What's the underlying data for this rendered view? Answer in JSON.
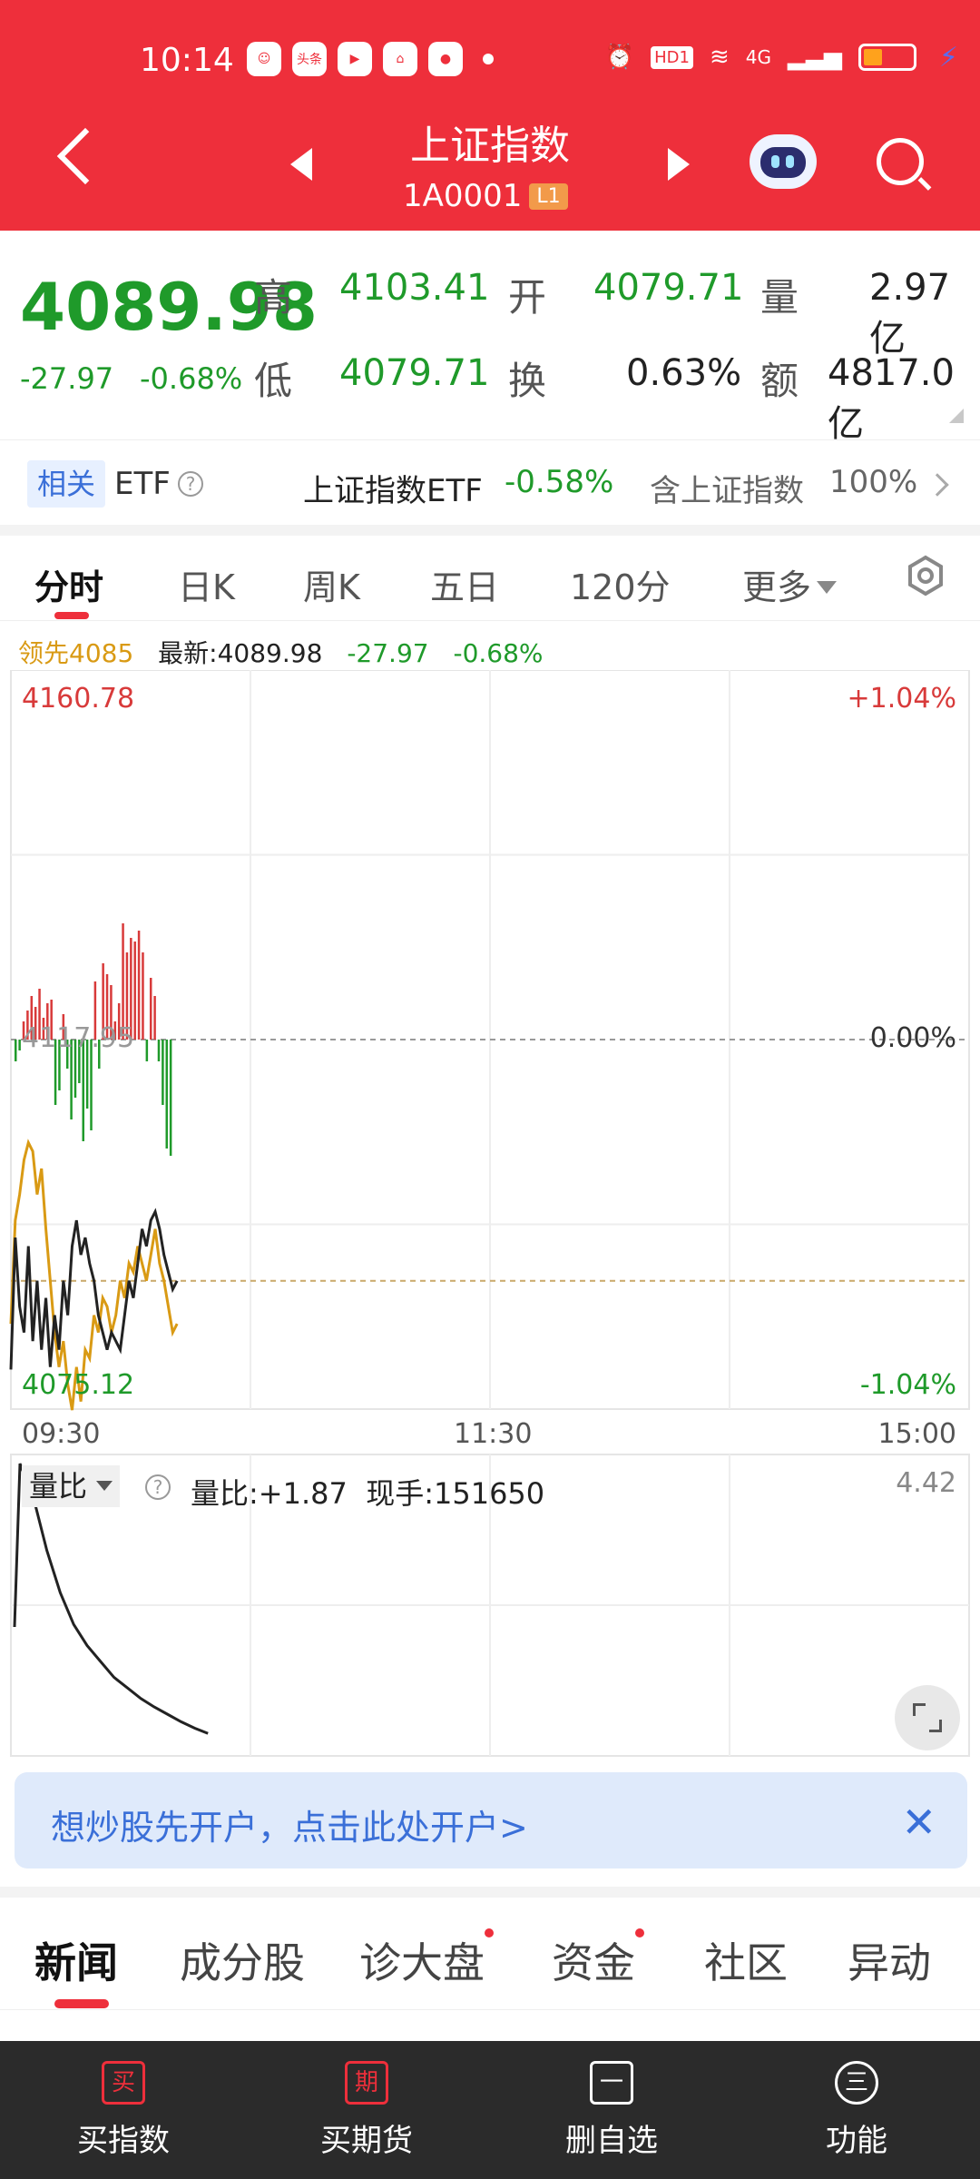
{
  "status_bar": {
    "time": "10:14",
    "app_badge": "头条",
    "signal": "4G",
    "hd": "HD1"
  },
  "header": {
    "title": "上证指数",
    "code": "1A0001",
    "level_badge": "L1"
  },
  "quote": {
    "price": "4089.98",
    "change": "-27.97",
    "change_pct": "-0.68%",
    "labels": {
      "high": "高",
      "low": "低",
      "open": "开",
      "turnover": "换",
      "volume": "量",
      "amount": "额"
    },
    "high": "4103.41",
    "low": "4079.71",
    "open": "4079.71",
    "turnover": "0.63%",
    "volume": "2.97亿",
    "amount": "4817.0亿"
  },
  "etf": {
    "tag": "相关",
    "label": "ETF",
    "help": "?",
    "name": "上证指数ETF",
    "change": "-0.58%",
    "note": "含上证指数",
    "weight": "100%"
  },
  "chart_tabs": [
    "分时",
    "日K",
    "周K",
    "五日",
    "120分",
    "更多"
  ],
  "legend": {
    "lead": "领先4085",
    "latest": "最新:4089.98",
    "change": "-27.97",
    "change_pct": "-0.68%"
  },
  "colors": {
    "up": "#d83a3a",
    "down": "#1f9a2a",
    "lead": "#d99a14",
    "brand": "#ee2f3b"
  },
  "chart_data": {
    "type": "line",
    "ymax": "4160.78",
    "ymin": "4075.12",
    "ymax_pct": "+1.04%",
    "ymin_pct": "-1.04%",
    "mid_pct": "0.00%",
    "prev_close_label": "4117.95",
    "x_ticks": [
      "09:30",
      "11:30",
      "15:00"
    ],
    "series": [
      {
        "values": [
          4079.7,
          4095,
          4087,
          4084,
          4094,
          4083,
          4090,
          4082,
          4088,
          4080,
          4086,
          4082,
          4090,
          4086,
          4094,
          4097,
          4093,
          4095,
          4092,
          4090,
          4086,
          4084,
          4082,
          4084,
          4083,
          4082,
          4086,
          4090,
          4088,
          4092,
          4096,
          4094,
          4097,
          4098,
          4096,
          4093,
          4091,
          4089,
          4089.98
        ]
      },
      {
        "values": [
          4085,
          4097,
          4100,
          4104,
          4106,
          4105,
          4100,
          4103,
          4096,
          4090,
          4084,
          4080,
          4083,
          4078,
          4075,
          4080,
          4076,
          4082,
          4081,
          4086,
          4084,
          4088,
          4087,
          4084,
          4086,
          4090,
          4088,
          4092,
          4091,
          4094,
          4092,
          4090,
          4093,
          4096,
          4092,
          4090,
          4087,
          4084,
          4085
        ]
      }
    ],
    "bars": [
      -6,
      -3,
      5,
      8,
      12,
      9,
      14,
      6,
      10,
      11,
      -18,
      -14,
      7,
      -8,
      -22,
      -16,
      -12,
      -28,
      -19,
      -25,
      16,
      -8,
      21,
      18,
      15,
      5,
      10,
      32,
      24,
      28,
      27,
      30,
      24,
      -6,
      17,
      12,
      -6,
      -18,
      -30,
      -32
    ],
    "volume_ratio": {
      "max": "4.42",
      "values": [
        4.42,
        4.1,
        3.6,
        3.2,
        2.9,
        2.7,
        2.55,
        2.4,
        2.3,
        2.2,
        2.12,
        2.05,
        1.98,
        1.92,
        1.87
      ]
    }
  },
  "volume_panel": {
    "selector": "量比",
    "ratio": "量比:+1.87",
    "hand": "现手:151650"
  },
  "banner": {
    "text": "想炒股先开户，点击此处开户>"
  },
  "news_tabs": [
    "新闻",
    "成分股",
    "诊大盘",
    "资金",
    "社区",
    "异动"
  ],
  "bottom_bar": [
    {
      "icon": "买",
      "label": "买指数"
    },
    {
      "icon": "期",
      "label": "买期货"
    },
    {
      "icon": "一",
      "label": "删自选"
    },
    {
      "icon": "三",
      "label": "功能"
    }
  ]
}
